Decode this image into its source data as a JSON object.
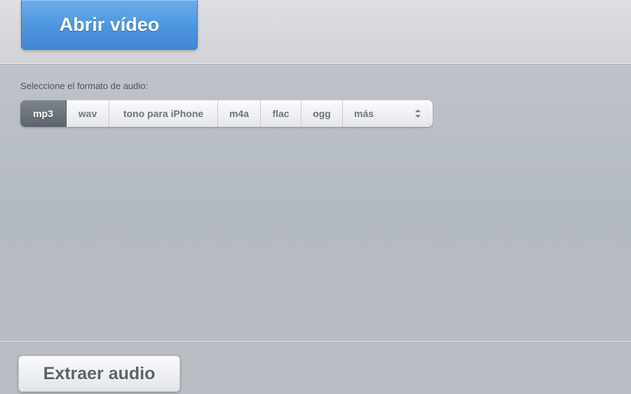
{
  "toolbar": {
    "open_video_label": "Abrir vídeo"
  },
  "format_selector": {
    "label": "Seleccione el formato de audio:",
    "selected": "mp3",
    "options": [
      "mp3",
      "wav",
      "tono para iPhone",
      "m4a",
      "flac",
      "ogg"
    ],
    "more_label": "más",
    "more_icon": "up-down-arrows-icon"
  },
  "footer": {
    "extract_label": "Extraer audio"
  },
  "colors": {
    "primary_button": "#4d95df",
    "active_format": "#5e646d",
    "background": "#b4bac2"
  }
}
